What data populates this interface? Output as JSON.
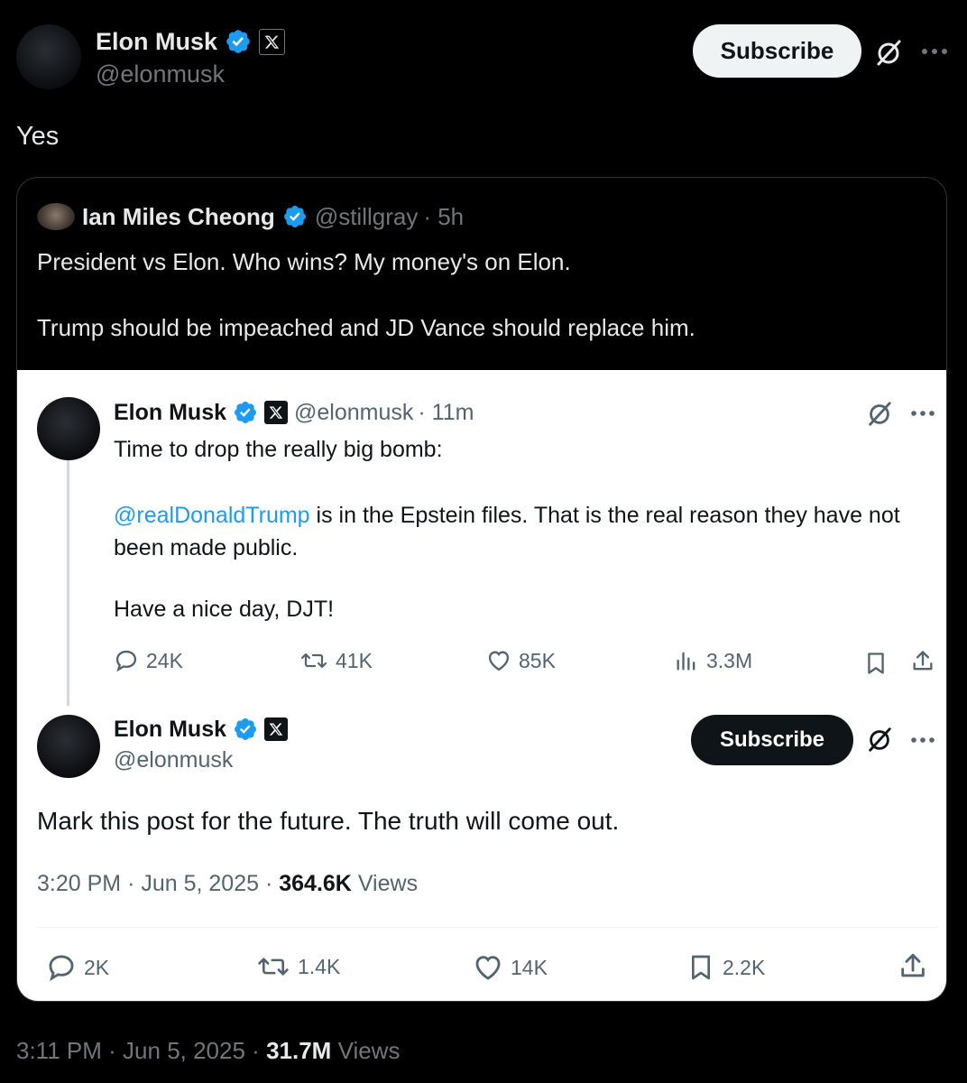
{
  "outer_post": {
    "author": {
      "display_name": "Elon Musk",
      "handle": "@elonmusk"
    },
    "subscribe_label": "Subscribe",
    "text": "Yes",
    "footer": {
      "time": "3:11 PM",
      "date": "Jun 5, 2025",
      "views_count": "31.7M",
      "views_label": "Views",
      "sep": "·"
    }
  },
  "quoted_post": {
    "author": {
      "display_name": "Ian Miles Cheong",
      "handle": "@stillgray",
      "age": "· 5h"
    },
    "line1": "President vs Elon. Who wins? My money's on Elon.",
    "line2": "Trump should be impeached and JD Vance should replace him."
  },
  "screenshot_thread": {
    "first": {
      "author": {
        "display_name": "Elon Musk",
        "handle": "@elonmusk",
        "age": "· 11m"
      },
      "line1": "Time to drop the really big bomb:",
      "mention": "@realDonaldTrump",
      "line2_rest": " is in the Epstein files. That is the real reason they have not been made public.",
      "line3": "Have a nice day, DJT!",
      "stats": {
        "replies": "24K",
        "reposts": "41K",
        "likes": "85K",
        "views": "3.3M"
      }
    },
    "second": {
      "author": {
        "display_name": "Elon Musk",
        "handle": "@elonmusk"
      },
      "subscribe_label": "Subscribe",
      "text": "Mark this post for the future. The truth will come out.",
      "footer": {
        "time": "3:20 PM",
        "date": "Jun 5, 2025",
        "views_count": "364.6K",
        "views_label": "Views",
        "sep": "·"
      },
      "stats": {
        "replies": "2K",
        "reposts": "1.4K",
        "likes": "14K",
        "bookmarks": "2.2K"
      }
    }
  },
  "colors": {
    "verified": "#1d9bf0",
    "link": "#1d9bf0",
    "dark_bg": "#000000",
    "light_bg": "#ffffff"
  }
}
